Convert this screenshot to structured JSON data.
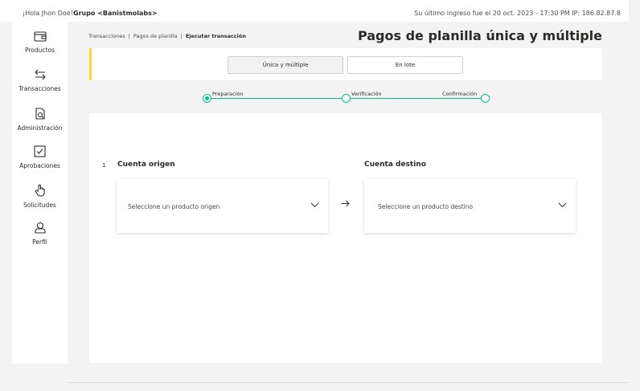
{
  "header": {
    "greeting": "¡Hola Jhon Doe!",
    "group": "Grupo <Banistmolabs>",
    "last_login": "Su último ingreso fue el 20 oct. 2023 - 17:30 PM IP: 186.82.87.8"
  },
  "sidebar": {
    "items": [
      {
        "label": "Productos",
        "icon": "wallet-icon"
      },
      {
        "label": "Transacciones",
        "icon": "transfer-arrows-icon"
      },
      {
        "label": "Administración",
        "icon": "document-search-icon"
      },
      {
        "label": "Aprobaciones",
        "icon": "checkbox-icon"
      },
      {
        "label": "Solicitudes",
        "icon": "hand-pointer-icon"
      },
      {
        "label": "Perfil",
        "icon": "user-icon"
      }
    ]
  },
  "breadcrumb": {
    "items": [
      "Transacciones",
      "Pagos de planilla",
      "Ejecutar transacción"
    ],
    "separator": "|"
  },
  "page_title": "Pagos de planilla única y múltiple",
  "tabs": [
    {
      "label": "Única y múltiple",
      "active": true
    },
    {
      "label": "En lote",
      "active": false
    }
  ],
  "steps": [
    {
      "label": "Preparación",
      "active": true
    },
    {
      "label": "Verificación",
      "active": false
    },
    {
      "label": "Confirmación",
      "active": false
    }
  ],
  "form": {
    "section_number": "1",
    "origin": {
      "title": "Cuenta origen",
      "placeholder": "Seleccione un producto origen"
    },
    "destination": {
      "title": "Cuenta destino",
      "placeholder": "Seleccione un producto destino"
    }
  },
  "colors": {
    "accent_green": "#00c389",
    "accent_yellow": "#fdda24",
    "text_dark": "#2c2a29"
  }
}
